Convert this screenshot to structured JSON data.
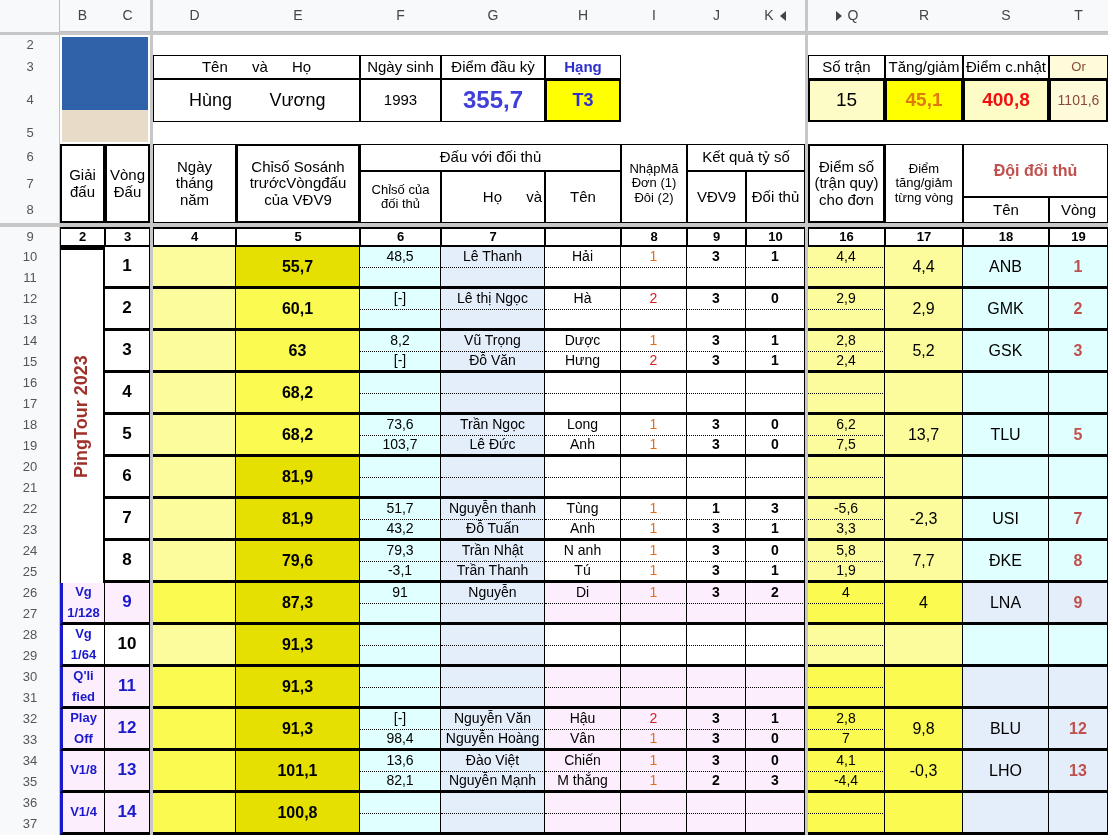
{
  "column_headers": [
    "B",
    "C",
    "D",
    "E",
    "F",
    "G",
    "H",
    "I",
    "J",
    "K",
    "Q",
    "R",
    "S",
    "T"
  ],
  "row_numbers": [
    "2",
    "3",
    "4",
    "5",
    "6",
    "7",
    "8",
    "9",
    "10",
    "11",
    "12",
    "13",
    "14",
    "15",
    "16",
    "17",
    "18",
    "19",
    "20",
    "21",
    "22",
    "23",
    "24",
    "25",
    "26",
    "27",
    "28",
    "29",
    "30",
    "31",
    "32",
    "33",
    "34",
    "35",
    "36",
    "37"
  ],
  "profile": {
    "name_header": "Tên và Họ",
    "birth_header": "Ngày sinh",
    "start_points_header": "Điểm đầu kỳ",
    "rank_header": "Hạng",
    "first_name": "Hùng",
    "last_name": "Vương",
    "birth_year": "1993",
    "start_points": "355,7",
    "rank": "T3"
  },
  "summary": {
    "headers": [
      "Số trận",
      "Tăng/giảm",
      "Điểm c.nhật",
      "Or"
    ],
    "values": [
      "15",
      "45,1",
      "400,8",
      "1101,6"
    ]
  },
  "table_header": {
    "event": "Giải đấu",
    "round": "Vòng Đấu",
    "date": "Ngày tháng năm",
    "index": "Chỉsố Sosánh trướcVòngđấu của VĐV9",
    "opponent_group": "Đấu với đối thủ",
    "opponent_index": "Chỉsố của đối thủ",
    "opponent_name": "Họ và",
    "opponent_first_name": "Tên",
    "code": "NhậpMã Đơn (1) Đôi (2)",
    "score_group": "Kết quả tỷ số",
    "score_self": "VĐV9",
    "score_opponent": "Đối thủ",
    "points": "Điểm số (trận quy) cho đơn",
    "delta": "Điểm tăng/giảm từng vòng",
    "team_group": "Đội đối thủ",
    "team_name": "Tên",
    "team_round": "Vòng"
  },
  "column_numbers": [
    "2",
    "3",
    "4",
    "5",
    "6",
    "7",
    "8",
    "9",
    "10",
    "16",
    "17",
    "18",
    "19"
  ],
  "events": [
    {
      "label": "PingTour 2023",
      "kind": "vertical",
      "tinted": false,
      "rounds": [
        {
          "round": "1",
          "index": "55,7",
          "dark": true,
          "delta": "4,4",
          "team": "ANB",
          "team_round": "1",
          "matches": [
            {
              "opponent_index": "48,5",
              "name": "Lê Thanh",
              "first_name": "Hải",
              "code": "1",
              "color": "#e07020",
              "self": "3",
              "opponent": "1",
              "points": "4,4"
            }
          ]
        },
        {
          "round": "2",
          "index": "60,1",
          "dark": false,
          "delta": "2,9",
          "team": "GMK",
          "team_round": "2",
          "matches": [
            {
              "opponent_index": "[-]",
              "name": "Lê thị Ngọc",
              "first_name": "Hà",
              "code": "2",
              "color": "#d42020",
              "self": "3",
              "opponent": "0",
              "points": "2,9"
            }
          ]
        },
        {
          "round": "3",
          "index": "63",
          "dark": false,
          "delta": "5,2",
          "team": "GSK",
          "team_round": "3",
          "matches": [
            {
              "opponent_index": "8,2",
              "name": "Vũ Trọng",
              "first_name": "Dược",
              "code": "1",
              "color": "#e07020",
              "self": "3",
              "opponent": "1",
              "points": "2,8"
            },
            {
              "opponent_index": "[-]",
              "name": "Đỗ Văn",
              "first_name": "Hưng",
              "code": "2",
              "color": "#d42020",
              "self": "3",
              "opponent": "1",
              "points": "2,4"
            }
          ]
        },
        {
          "round": "4",
          "index": "68,2",
          "dark": false
        },
        {
          "round": "5",
          "index": "68,2",
          "dark": false,
          "delta": "13,7",
          "team": "TLU",
          "team_round": "5",
          "matches": [
            {
              "opponent_index": "73,6",
              "name": "Trần Ngọc",
              "first_name": "Long",
              "code": "1",
              "color": "#e07020",
              "self": "3",
              "opponent": "0",
              "points": "6,2"
            },
            {
              "opponent_index": "103,7",
              "name": "Lê Đức",
              "first_name": "Anh",
              "code": "1",
              "color": "#e07020",
              "self": "3",
              "opponent": "0",
              "points": "7,5"
            }
          ]
        },
        {
          "round": "6",
          "index": "81,9",
          "dark": true
        },
        {
          "round": "7",
          "index": "81,9",
          "dark": true,
          "delta": "-2,3",
          "team": "USI",
          "team_round": "7",
          "matches": [
            {
              "opponent_index": "51,7",
              "name": "Nguyễn thanh",
              "first_name": "Tùng",
              "code": "1",
              "color": "#e07020",
              "self": "1",
              "opponent": "3",
              "points": "-5,6"
            },
            {
              "opponent_index": "43,2",
              "name": "Đỗ Tuấn",
              "first_name": "Anh",
              "code": "1",
              "color": "#e07020",
              "self": "3",
              "opponent": "1",
              "points": "3,3"
            }
          ]
        },
        {
          "round": "8",
          "index": "79,6",
          "dark": true,
          "delta": "7,7",
          "team": "ĐKE",
          "team_round": "8",
          "matches": [
            {
              "opponent_index": "79,3",
              "name": "Trần Nhật",
              "first_name": "N anh",
              "code": "1",
              "color": "#e07020",
              "self": "3",
              "opponent": "0",
              "points": "5,8"
            },
            {
              "opponent_index": "-3,1",
              "name": "Trần Thanh",
              "first_name": "Tú",
              "code": "1",
              "color": "#e07020",
              "self": "3",
              "opponent": "1",
              "points": "1,9"
            }
          ]
        }
      ]
    },
    {
      "label": "Vg 1/128",
      "kind": "stage",
      "tinted": true,
      "rounds": [
        {
          "round": "9",
          "index": "87,3",
          "dark": true,
          "delta": "4",
          "team": "LNA",
          "team_round": "9",
          "matches": [
            {
              "opponent_index": "91",
              "name": "Nguyễn",
              "first_name": "Di",
              "code": "1",
              "color": "#e07020",
              "self": "3",
              "opponent": "2",
              "points": "4"
            }
          ]
        }
      ]
    },
    {
      "label": "Vg 1/64",
      "kind": "stage",
      "tinted": false,
      "rounds": [
        {
          "round": "10",
          "index": "91,3",
          "dark": true
        }
      ]
    },
    {
      "label": "Q'li fied",
      "kind": "stage",
      "tinted": true,
      "rounds": [
        {
          "round": "11",
          "index": "91,3",
          "dark": true
        }
      ]
    },
    {
      "label": "Play Off",
      "kind": "stage",
      "tinted": true,
      "rounds": [
        {
          "round": "12",
          "index": "91,3",
          "dark": true,
          "delta": "9,8",
          "team": "BLU",
          "team_round": "12",
          "matches": [
            {
              "opponent_index": "[-]",
              "name": "Nguyễn Văn",
              "first_name": "Hậu",
              "code": "2",
              "color": "#d42020",
              "self": "3",
              "opponent": "1",
              "points": "2,8"
            },
            {
              "opponent_index": "98,4",
              "name": "Nguyễn Hoàng",
              "first_name": "Vân",
              "code": "1",
              "color": "#e07020",
              "self": "3",
              "opponent": "0",
              "points": "7"
            }
          ]
        }
      ]
    },
    {
      "label": "V1/8",
      "kind": "stage",
      "tinted": true,
      "rounds": [
        {
          "round": "13",
          "index": "101,1",
          "dark": true,
          "delta": "-0,3",
          "team": "LHO",
          "team_round": "13",
          "matches": [
            {
              "opponent_index": "13,6",
              "name": "Đào Việt",
              "first_name": "Chiến",
              "code": "1",
              "color": "#e07020",
              "self": "3",
              "opponent": "0",
              "points": "4,1"
            },
            {
              "opponent_index": "82,1",
              "name": "Nguyễn Mạnh",
              "first_name": "M thắng",
              "code": "1",
              "color": "#e07020",
              "self": "2",
              "opponent": "3",
              "points": "-4,4"
            }
          ]
        }
      ]
    },
    {
      "label": "V1/4",
      "kind": "stage",
      "tinted": true,
      "rounds": [
        {
          "round": "14",
          "index": "100,8",
          "dark": true
        }
      ]
    }
  ]
}
